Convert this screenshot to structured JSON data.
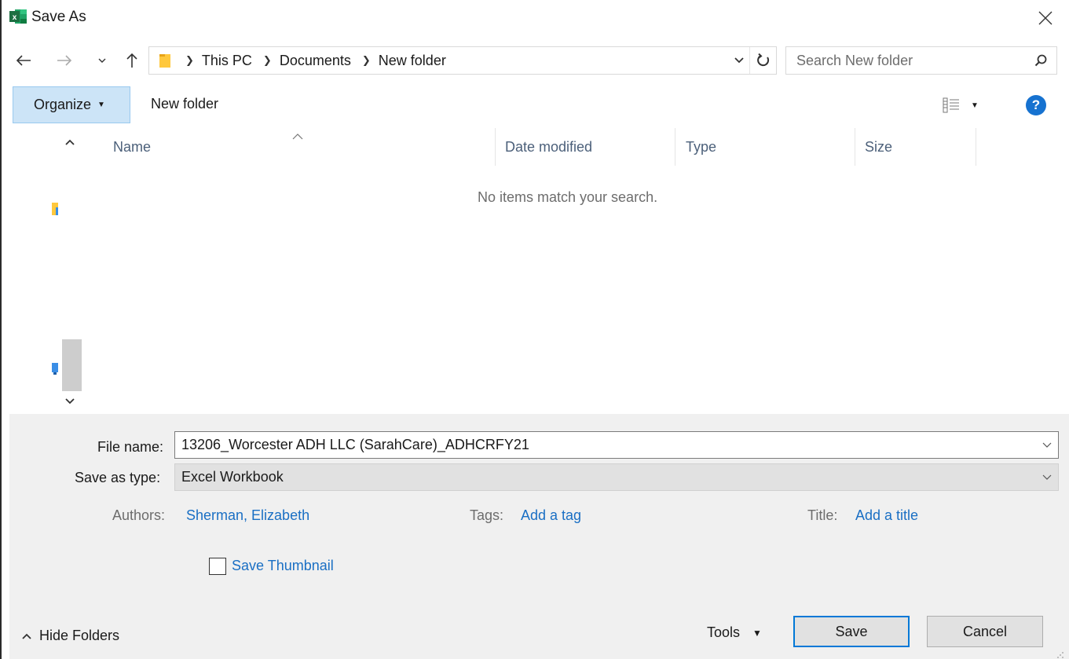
{
  "window": {
    "title": "Save As",
    "app_icon": "excel-icon",
    "close_icon": "close-icon"
  },
  "navigation": {
    "back_icon": "arrow-left-icon",
    "forward_icon": "arrow-right-icon",
    "recent_icon": "chevron-down-icon",
    "up_icon": "arrow-up-icon",
    "breadcrumbs": [
      "This PC",
      "Documents",
      "New folder"
    ],
    "folder_icon": "folder-icon",
    "refresh_icon": "refresh-icon",
    "search_placeholder": "Search New folder",
    "search_icon": "search-icon"
  },
  "toolbar": {
    "organize_label": "Organize",
    "new_folder_label": "New folder",
    "view_icon": "view-details-icon",
    "help_label": "?"
  },
  "file_list": {
    "columns": [
      "Name",
      "Date modified",
      "Type",
      "Size"
    ],
    "empty_message": "No items match your search."
  },
  "form": {
    "file_name_label": "File name:",
    "file_name_value": "13206_Worcester ADH LLC (SarahCare)_ADHCRFY21",
    "save_as_type_label": "Save as type:",
    "save_as_type_value": "Excel Workbook",
    "authors_label": "Authors:",
    "authors_value": "Sherman, Elizabeth",
    "tags_label": "Tags:",
    "tags_value": "Add a tag",
    "title_label": "Title:",
    "title_value": "Add a title",
    "save_thumbnail_label": "Save Thumbnail",
    "save_thumbnail_checked": false
  },
  "footer": {
    "hide_folders_label": "Hide Folders",
    "tools_label": "Tools",
    "save_label": "Save",
    "cancel_label": "Cancel"
  },
  "colors": {
    "accent": "#0078d7",
    "link": "#1a6fc4",
    "organize_bg": "#cce4f7",
    "excel_green": "#1d6f42"
  }
}
